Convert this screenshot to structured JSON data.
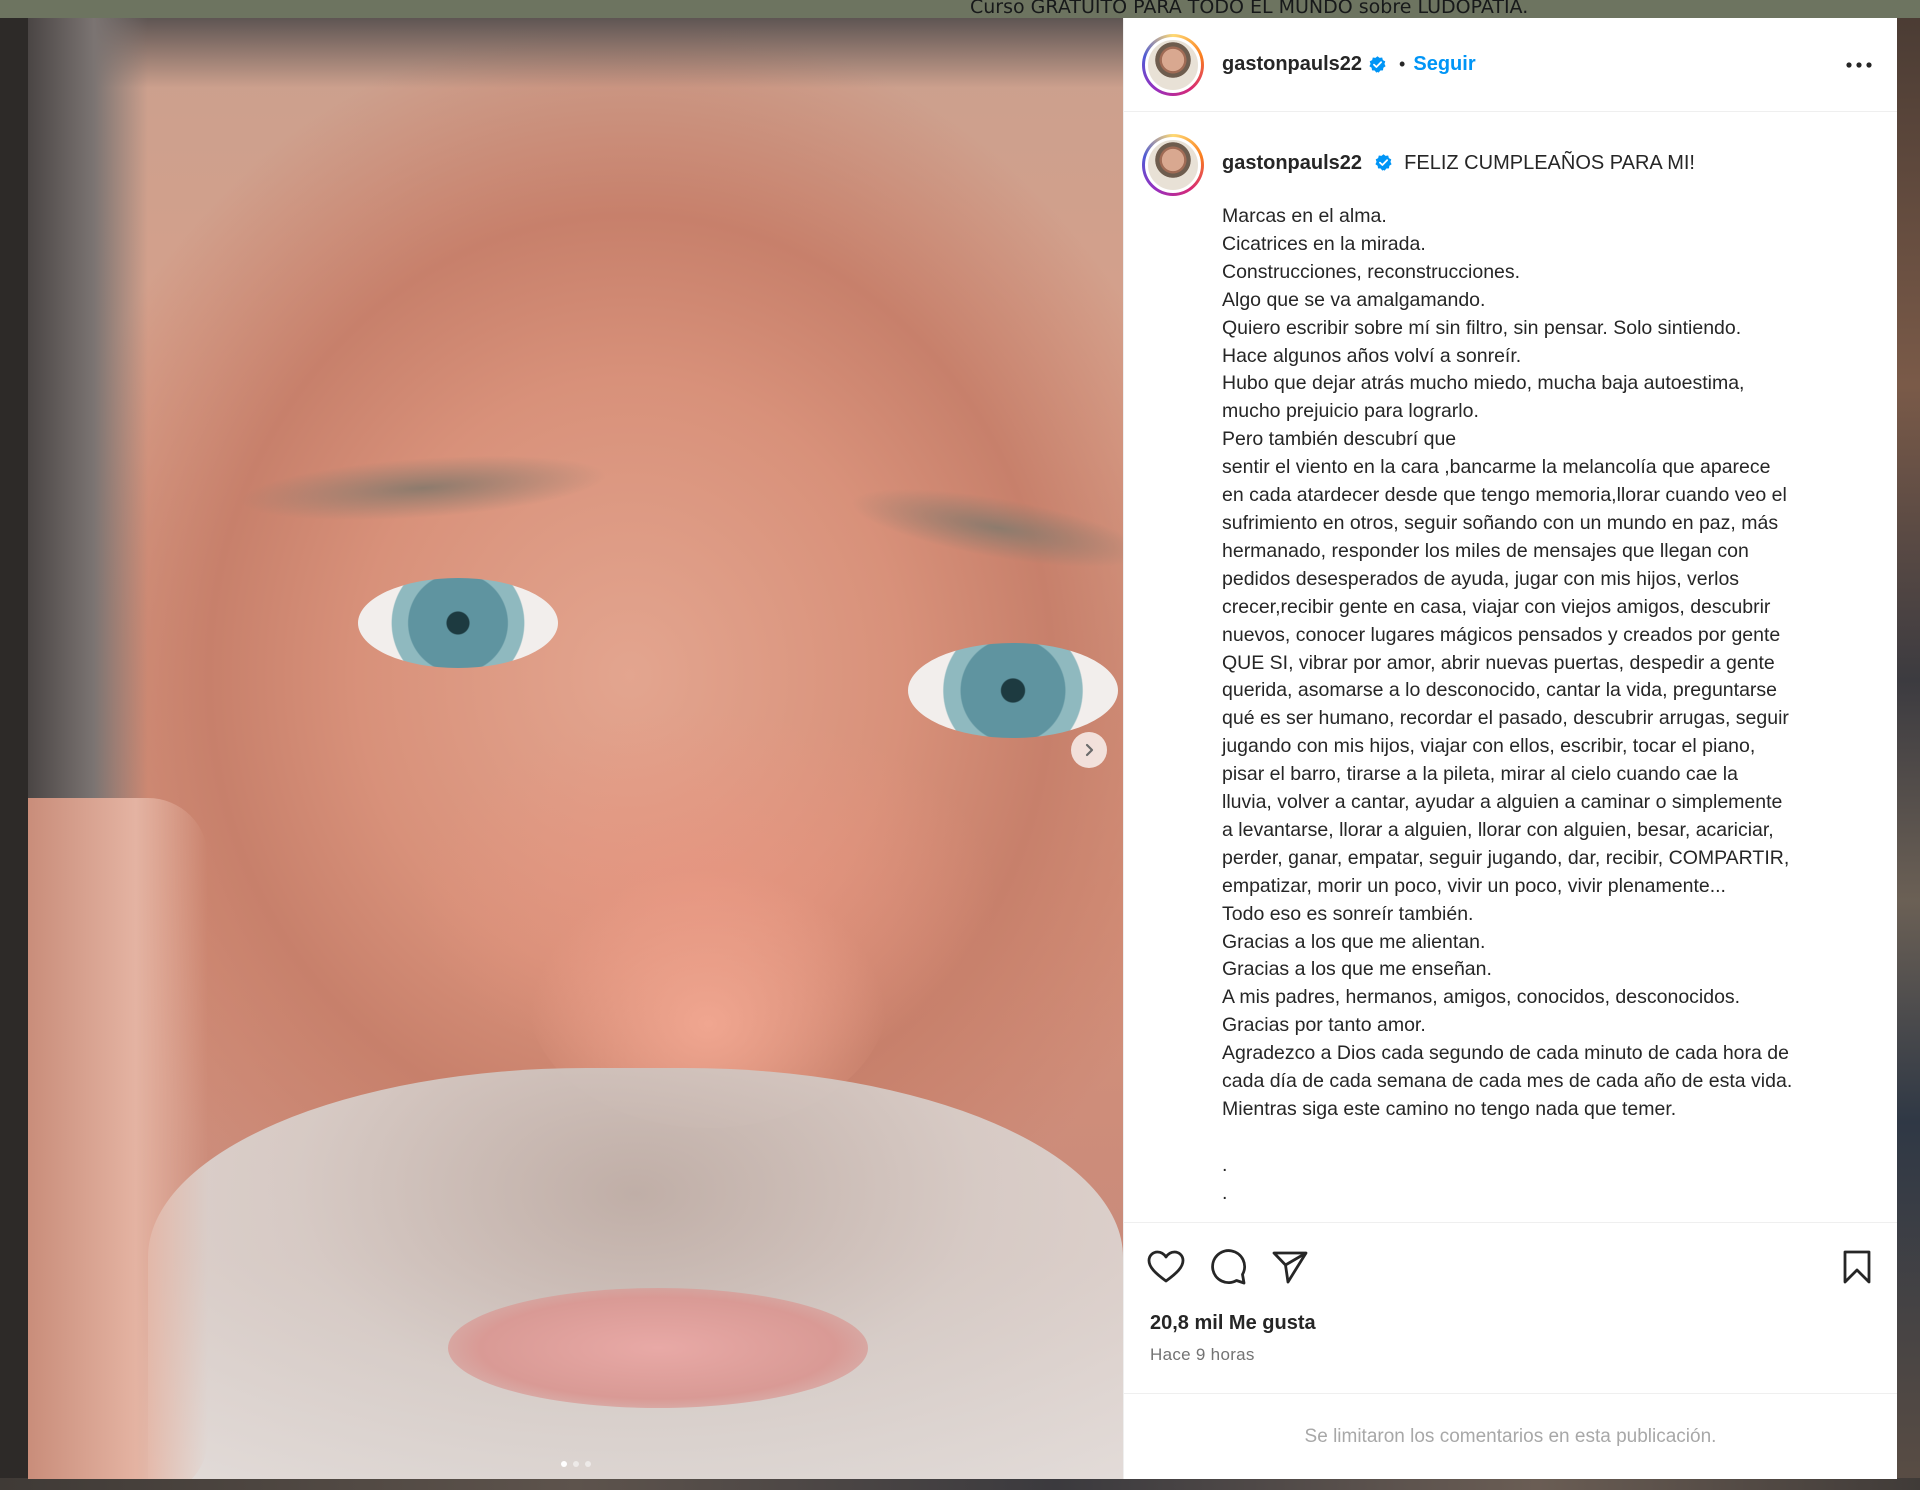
{
  "background": {
    "banner_text": "Curso GRATUITO PARA TODO EL MUNDO sobre LUDOPATÍA."
  },
  "post": {
    "header": {
      "username": "gastonpauls22",
      "separator": "•",
      "follow_label": "Seguir"
    },
    "caption": {
      "username": "gastonpauls22",
      "headline": "FELIZ CUMPLEAÑOS PARA MI!",
      "lines": [
        "Marcas en el alma.",
        "Cicatrices en la mirada.",
        "Construcciones, reconstrucciones.",
        "Algo que se va amalgamando.",
        "Quiero escribir sobre mí sin filtro, sin pensar. Solo sintiendo.",
        "Hace algunos años volví a sonreír.",
        "Hubo que dejar atrás mucho miedo, mucha baja autoestima,",
        "mucho prejuicio para lograrlo.",
        "Pero también descubrí que",
        "sentir el viento en la cara ,bancarme la melancolía que aparece",
        "en cada atardecer desde que tengo memoria,llorar cuando veo el",
        "sufrimiento en otros, seguir soñando con un mundo en paz, más",
        "hermanado, responder los miles de mensajes que llegan con",
        "pedidos desesperados de ayuda, jugar con mis hijos, verlos",
        "crecer,recibir gente en casa, viajar con viejos amigos, descubrir",
        "nuevos, conocer lugares mágicos pensados y creados por gente",
        "QUE SI, vibrar por amor, abrir nuevas puertas, despedir a gente",
        "querida, asomarse a lo desconocido, cantar la vida, preguntarse",
        "qué es ser humano, recordar el pasado, descubrir arrugas, seguir",
        "jugando con mis hijos, viajar con ellos, escribir, tocar el piano,",
        "pisar el barro, tirarse a la pileta, mirar al cielo cuando cae la",
        "lluvia, volver a cantar, ayudar a alguien a caminar o simplemente",
        "a levantarse, llorar a alguien, llorar con alguien, besar, acariciar,",
        "perder, ganar, empatar, seguir jugando, dar, recibir, COMPARTIR,",
        "empatizar, morir un poco, vivir un poco, vivir plenamente...",
        "Todo eso es sonreír también.",
        "Gracias a los que me alientan.",
        "Gracias a los que me enseñan.",
        "A mis padres, hermanos, amigos, conocidos, desconocidos.",
        "Gracias por tanto amor.",
        "Agradezco a Dios cada segundo de cada minuto de cada hora de",
        "cada día de cada semana de cada mes de cada año de esta vida.",
        "Mientras siga este camino no tengo nada que temer.",
        "",
        ".",
        ".",
        "."
      ]
    },
    "likes": "20,8 mil Me gusta",
    "timestamp": "Hace 9 horas",
    "comments_notice": "Se limitaron los comentarios en esta publicación.",
    "icons": {
      "like": "heart-icon",
      "comment": "comment-icon",
      "share": "paper-plane-icon",
      "save": "bookmark-icon",
      "more": "more-horizontal-icon",
      "next": "chevron-right-icon",
      "verified": "verified-badge-icon"
    },
    "colors": {
      "link": "#0095f6",
      "verified": "#0095f6",
      "text": "#262626",
      "secondary": "#737373",
      "muted": "#a8a8a8"
    }
  }
}
